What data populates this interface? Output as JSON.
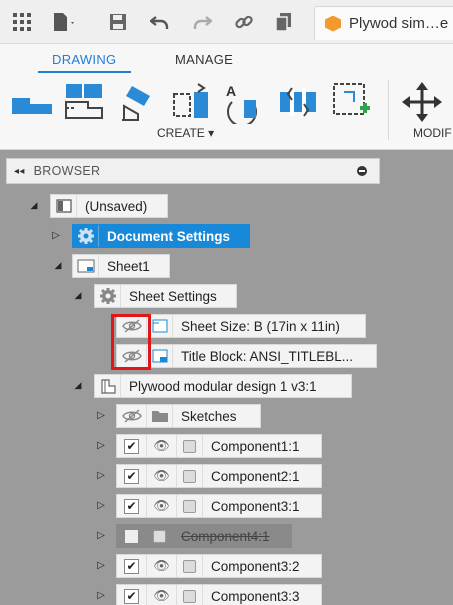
{
  "appbar": {
    "doc_tab_title": "Plywod sim…e",
    "icons": [
      "grid-icon",
      "file-icon",
      "save-icon",
      "undo-icon",
      "redo-icon",
      "link-icon",
      "copy-icon"
    ]
  },
  "ribbon": {
    "tabs": [
      {
        "label": "DRAWING",
        "active": true
      },
      {
        "label": "MANAGE",
        "active": false
      }
    ],
    "create_label": "CREATE ▾",
    "modify_label": "MODIF",
    "accent": "#1e7fd6"
  },
  "browser": {
    "title": "BROWSER",
    "root": "(Unsaved)",
    "document_settings": "Document Settings",
    "sheet": "Sheet1",
    "sheet_settings": "Sheet Settings",
    "sheet_size": "Sheet Size: B (17in x 11in)",
    "title_block": "Title Block: ANSI_TITLEBL...",
    "design": "Plywood modular design 1 v3:1",
    "sketches": "Sketches",
    "components": [
      {
        "label": "Component1:1",
        "checked": true,
        "visible": true
      },
      {
        "label": "Component2:1",
        "checked": true,
        "visible": true
      },
      {
        "label": "Component3:1",
        "checked": true,
        "visible": true
      },
      {
        "label": "Component4:1",
        "checked": false,
        "visible": false
      },
      {
        "label": "Component3:2",
        "checked": true,
        "visible": true
      },
      {
        "label": "Component3:3",
        "checked": true,
        "visible": true
      }
    ],
    "highlight_color": "#e1161b"
  }
}
